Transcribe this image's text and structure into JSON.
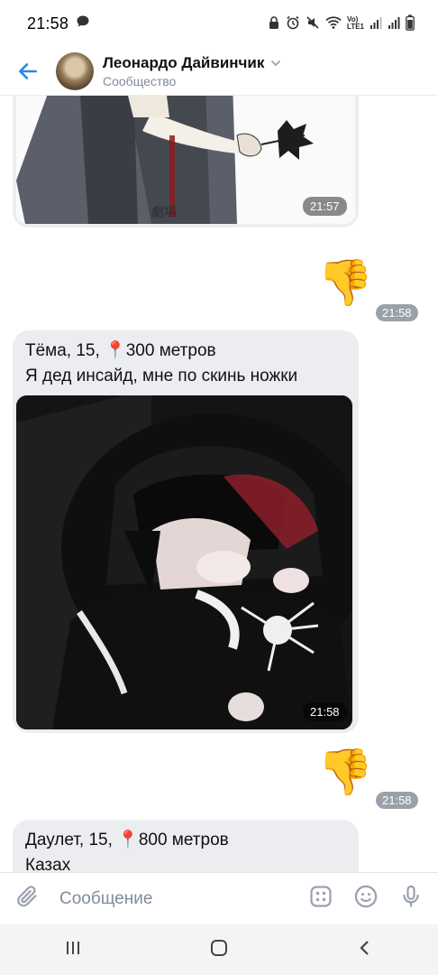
{
  "status_bar": {
    "time": "21:58",
    "lte": "Vo))\nLTE1"
  },
  "header": {
    "title": "Леонардо Дайвинчик",
    "subtitle": "Сообщество"
  },
  "messages": [
    {
      "type": "photo",
      "time": "21:57"
    },
    {
      "type": "sticker",
      "emoji": "👎",
      "time": "21:58"
    },
    {
      "type": "profile",
      "line1": "Тёма, 15, 📍300 метров",
      "line2": "Я дед инсайд, мне по скинь ножки",
      "time": "21:58"
    },
    {
      "type": "sticker",
      "emoji": "👎",
      "time": "21:58"
    },
    {
      "type": "profile",
      "line1": "Даулет, 15, 📍800 метров",
      "line2": "Казах"
    }
  ],
  "composer": {
    "placeholder": "Сообщение"
  },
  "colors": {
    "accent": "#2688eb",
    "bubble": "#ebedf0",
    "subtitle": "#818c99"
  }
}
